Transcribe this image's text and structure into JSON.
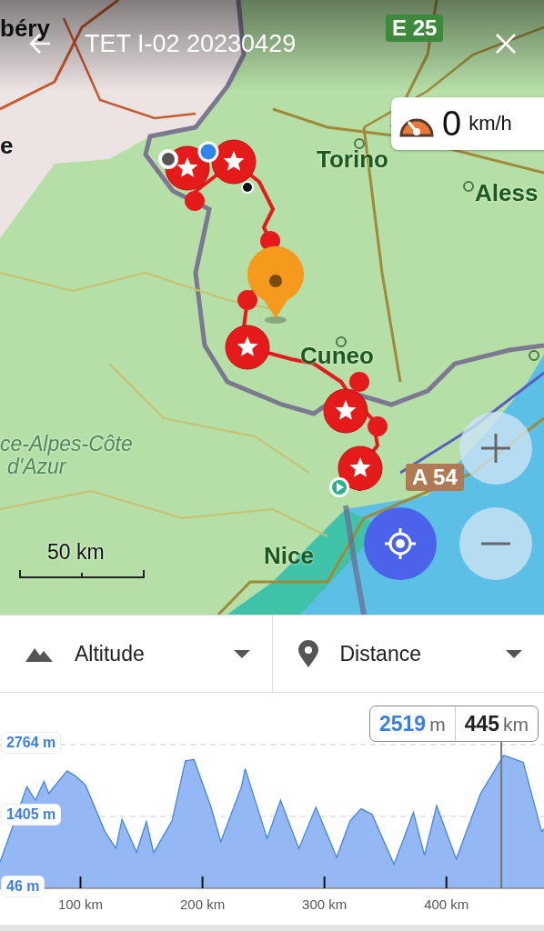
{
  "header": {
    "title": "TET I-02 20230429"
  },
  "speed": {
    "value": "0",
    "unit": "km/h"
  },
  "map_labels": [
    {
      "text": "béry",
      "kind": "town"
    },
    {
      "text": "e",
      "kind": "town"
    },
    {
      "text": "Torino",
      "kind": "city"
    },
    {
      "text": "Aless",
      "kind": "city"
    },
    {
      "text": "Cuneo",
      "kind": "city"
    },
    {
      "text": "ce-Alpes-Côte",
      "kind": "region"
    },
    {
      "text": "d'Azur",
      "kind": "region"
    },
    {
      "text": "Nice",
      "kind": "city"
    }
  ],
  "road_signs": [
    {
      "text": "E 25",
      "color": "#3d8a3d"
    },
    {
      "text": "A 54",
      "color": "#b07a55"
    }
  ],
  "scale": {
    "label": "50 km"
  },
  "selectors": [
    {
      "label": "Altitude",
      "kind": "altitude"
    },
    {
      "label": "Distance",
      "kind": "distance"
    }
  ],
  "chart": {
    "readout": {
      "value": "2519",
      "value_unit": "m",
      "distance": "445",
      "distance_unit": "km"
    },
    "chart_data": {
      "type": "area",
      "x": [
        34,
        56,
        63,
        70,
        74,
        89,
        96,
        104,
        120,
        129,
        134,
        146,
        154,
        160,
        175,
        186,
        193,
        207,
        215,
        232,
        235,
        253,
        264,
        279,
        293,
        310,
        321,
        330,
        339,
        357,
        373,
        382,
        392,
        408,
        428,
        447,
        463,
        478,
        480
      ],
      "xlim": [
        34,
        480
      ],
      "ylim": [
        46,
        3744
      ],
      "values": [
        540,
        1970,
        1710,
        2070,
        1840,
        2270,
        2170,
        2000,
        1120,
        800,
        1350,
        730,
        1310,
        720,
        1320,
        2460,
        2480,
        1580,
        930,
        1970,
        2310,
        990,
        1710,
        800,
        1580,
        630,
        1320,
        1550,
        1450,
        500,
        1480,
        670,
        1610,
        600,
        1840,
        2560,
        2430,
        1120,
        1170
      ],
      "yticks": [
        {
          "value": 46,
          "label": "46 m"
        },
        {
          "value": 1405,
          "label": "1405 m"
        },
        {
          "value": 2764,
          "label": "2764 m"
        }
      ],
      "xticks": [
        {
          "value": 100,
          "label": "100 km"
        },
        {
          "value": 200,
          "label": "200 km"
        },
        {
          "value": 300,
          "label": "300 km"
        },
        {
          "value": 400,
          "label": "400 km"
        }
      ]
    }
  }
}
